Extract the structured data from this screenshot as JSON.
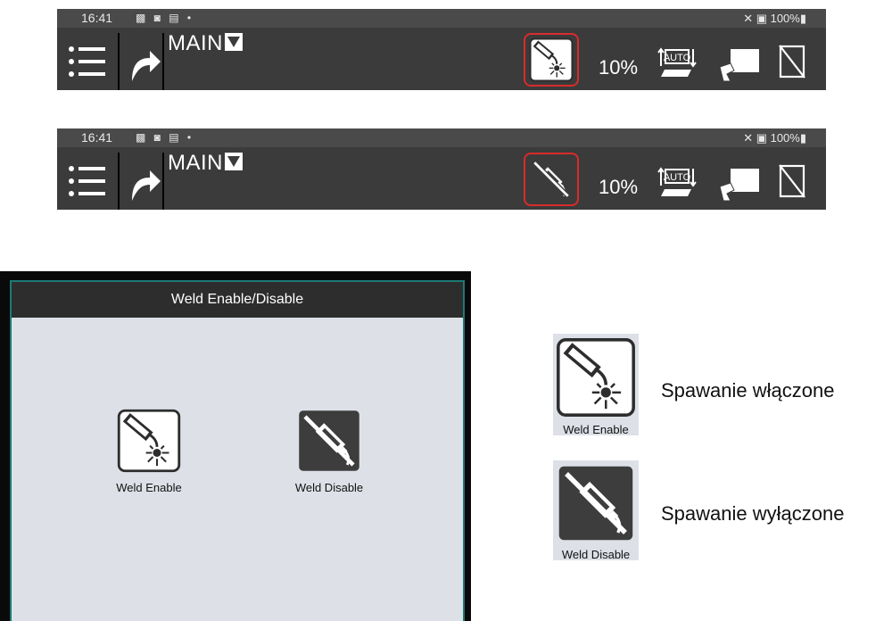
{
  "toolbar_top": {
    "status": {
      "time": "16:41",
      "icons": "▩ ◙ ▤ •",
      "right": "✕ ▣ 100%▮"
    },
    "title": "MAIN",
    "speed": "10%",
    "weld_state": "enabled"
  },
  "toolbar_bottom": {
    "status": {
      "time": "16:41",
      "icons": "▩ ◙ ▤ •",
      "right": "✕ ▣ 100%▮"
    },
    "title": "MAIN",
    "speed": "10%",
    "weld_state": "disabled"
  },
  "dialog": {
    "title": "Weld Enable/Disable",
    "enable_label": "Weld Enable",
    "disable_label": "Weld Disable"
  },
  "legend": {
    "enable_label": "Weld Enable",
    "enable_text": "Spawanie włączone",
    "disable_label": "Weld Disable",
    "disable_text": "Spawanie wyłączone"
  },
  "colors": {
    "toolbar": "#3b3b3b",
    "highlight": "#d92b2b",
    "dialog_border": "#1d7a76",
    "dialog_bg": "#dde1e7"
  }
}
